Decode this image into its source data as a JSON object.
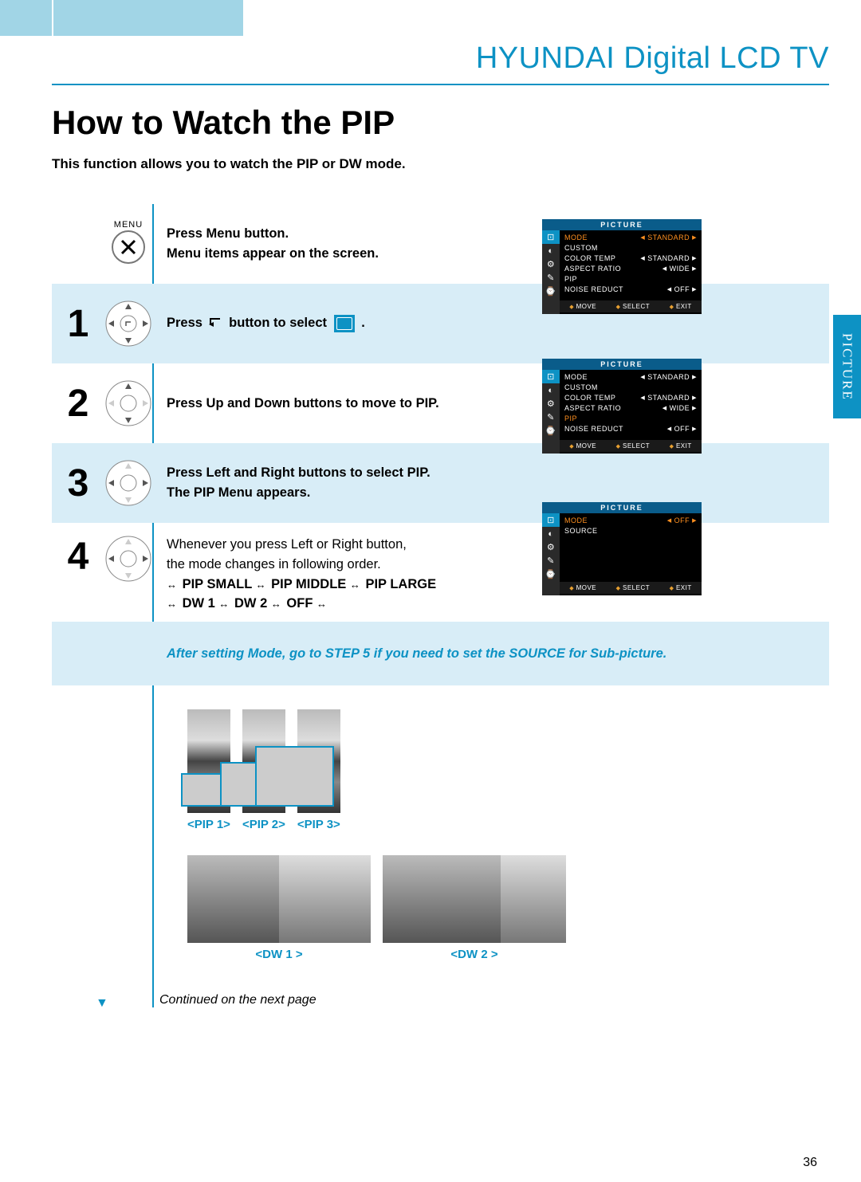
{
  "header": {
    "brand_title": "HYUNDAI Digital LCD TV"
  },
  "title": "How to Watch the PIP",
  "intro": "This function allows you to watch the PIP or DW mode.",
  "side_tab": "PICTURE",
  "menu_label": "MENU",
  "step0": {
    "line1": "Press Menu button.",
    "line2": "Menu items appear on the screen."
  },
  "steps": {
    "s1": {
      "num": "1",
      "pre": "Press",
      "post": "button to select",
      "end": "."
    },
    "s2": {
      "num": "2",
      "text": "Press Up and Down buttons to move to PIP."
    },
    "s3": {
      "num": "3",
      "line1": "Press Left and Right buttons to select PIP.",
      "line2": "The PIP Menu appears."
    },
    "s4": {
      "num": "4",
      "line1": "Whenever you press Left or Right button,",
      "line2": "the mode changes in following order.",
      "modes": "PIP SMALL ↔ PIP MIDDLE ↔ PIP LARGE",
      "modes2": "↔ DW 1 ↔ DW 2 ↔ OFF ↔"
    }
  },
  "note": "After setting Mode, go to STEP 5 if you need to set the SOURCE for Sub-picture.",
  "osd": {
    "header": "PICTURE",
    "rows": [
      {
        "label": "MODE",
        "value": "STANDARD"
      },
      {
        "label": "CUSTOM",
        "value": ""
      },
      {
        "label": "COLOR TEMP",
        "value": "STANDARD"
      },
      {
        "label": "ASPECT RATIO",
        "value": "WIDE"
      },
      {
        "label": "PIP",
        "value": ""
      },
      {
        "label": "NOISE REDUCT",
        "value": "OFF"
      }
    ],
    "footer": {
      "move": "MOVE",
      "select": "SELECT",
      "exit": "EXIT"
    }
  },
  "osd3_rows": [
    {
      "label": "MODE",
      "value": "OFF"
    },
    {
      "label": "SOURCE",
      "value": ""
    }
  ],
  "gallery": {
    "pip1": "<PIP 1>",
    "pip2": "<PIP 2>",
    "pip3": "<PIP 3>",
    "dw1": "<DW 1 >",
    "dw2": "<DW 2 >"
  },
  "continued": "Continued on the next page",
  "page_number": "36"
}
